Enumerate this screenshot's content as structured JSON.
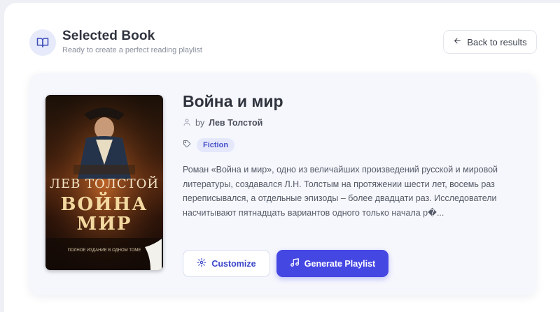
{
  "header": {
    "icon": "book-open-icon",
    "title": "Selected Book",
    "subtitle": "Ready to create a perfect reading playlist",
    "back_label": "Back to results",
    "back_icon": "arrow-left-icon"
  },
  "book": {
    "title": "Война и мир",
    "author_prefix": "by",
    "author": "Лев Толстой",
    "genre": "Fiction",
    "description": "Роман «Война и мир», одно из величайших произведений русской и мировой литературы, создавался Л.Н. Толстым на протяжении шести лет, восемь раз переписывался, а отдельные эпизоды – более двадцати раз. Исследователи насчитывают пятнадцать вариантов одного только начала р�...",
    "cover": {
      "author": "ЛЕВ ТОЛСТОЙ",
      "title_line1": "ВОЙНА",
      "title_line2": "МИР",
      "footer": "ПОЛНОЕ ИЗДАНИЕ В ОДНОМ ТОМЕ"
    }
  },
  "actions": {
    "customize_label": "Customize",
    "customize_icon": "settings-icon",
    "generate_label": "Generate Playlist",
    "generate_icon": "music-note-icon"
  },
  "colors": {
    "accent": "#4547e3",
    "badge_bg": "#e5e8fb",
    "badge_text": "#4650c8"
  }
}
